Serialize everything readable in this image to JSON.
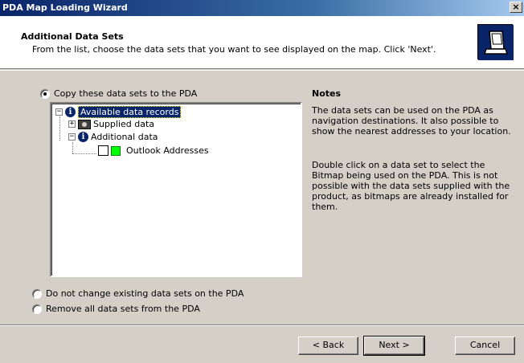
{
  "window": {
    "title": "PDA Map Loading Wizard",
    "close": "×"
  },
  "header": {
    "title": "Additional Data Sets",
    "subtitle": "From the list, choose the data sets that you want to see displayed on the map. Click 'Next'."
  },
  "options": {
    "copy": "Copy these data sets to the PDA",
    "no_change": "Do not change existing data sets on the PDA",
    "remove_all": "Remove all data sets from the PDA",
    "selected": "copy"
  },
  "tree": {
    "root": {
      "label": "Available data records",
      "expander": "−"
    },
    "supplied": {
      "label": "Supplied data",
      "expander": "+"
    },
    "additional": {
      "label": "Additional data",
      "expander": "−"
    },
    "outlook": {
      "label": "Outlook Addresses",
      "checked": false,
      "color": "#00ff00"
    }
  },
  "notes": {
    "title": "Notes",
    "para1": "The data sets can be used on the PDA as navigation destinations. It also possible to show the nearest addresses to your location.",
    "para2": "Double click on a data set to select the Bitmap being used on the PDA. This is not possible with the data sets supplied with the product, as bitmaps are already installed for them."
  },
  "buttons": {
    "back": "< Back",
    "next": "Next >",
    "cancel": "Cancel"
  }
}
